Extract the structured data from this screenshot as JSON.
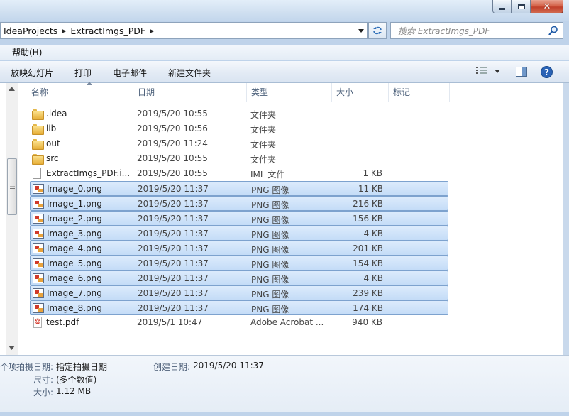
{
  "window": {
    "minimize_glyph": "",
    "close_glyph": "✕"
  },
  "address": {
    "crumbs": [
      "IdeaProjects",
      "ExtractImgs_PDF"
    ],
    "separator": "▶"
  },
  "search": {
    "placeholder": "搜索 ExtractImgs_PDF"
  },
  "menu": {
    "help": "帮助(H)"
  },
  "toolbar": {
    "slideshow": "放映幻灯片",
    "print": "打印",
    "email": "电子邮件",
    "new_folder": "新建文件夹"
  },
  "columns": {
    "name": "名称",
    "date": "日期",
    "type": "类型",
    "size": "大小",
    "tags": "标记"
  },
  "files": [
    {
      "name": ".idea",
      "date": "2019/5/20 10:55",
      "type": "文件夹",
      "size": "",
      "icon": "folder-icon",
      "selected": false
    },
    {
      "name": "lib",
      "date": "2019/5/20 10:56",
      "type": "文件夹",
      "size": "",
      "icon": "folder-icon",
      "selected": false
    },
    {
      "name": "out",
      "date": "2019/5/20 11:24",
      "type": "文件夹",
      "size": "",
      "icon": "folder-icon",
      "selected": false
    },
    {
      "name": "src",
      "date": "2019/5/20 10:55",
      "type": "文件夹",
      "size": "",
      "icon": "folder-icon",
      "selected": false
    },
    {
      "name": "ExtractImgs_PDF.i...",
      "date": "2019/5/20 10:55",
      "type": "IML 文件",
      "size": "1 KB",
      "icon": "document-icon",
      "selected": false
    },
    {
      "name": "Image_0.png",
      "date": "2019/5/20 11:37",
      "type": "PNG 图像",
      "size": "11 KB",
      "icon": "image-icon",
      "selected": true
    },
    {
      "name": "Image_1.png",
      "date": "2019/5/20 11:37",
      "type": "PNG 图像",
      "size": "216 KB",
      "icon": "image-icon",
      "selected": true
    },
    {
      "name": "Image_2.png",
      "date": "2019/5/20 11:37",
      "type": "PNG 图像",
      "size": "156 KB",
      "icon": "image-icon",
      "selected": true
    },
    {
      "name": "Image_3.png",
      "date": "2019/5/20 11:37",
      "type": "PNG 图像",
      "size": "4 KB",
      "icon": "image-icon",
      "selected": true
    },
    {
      "name": "Image_4.png",
      "date": "2019/5/20 11:37",
      "type": "PNG 图像",
      "size": "201 KB",
      "icon": "image-icon",
      "selected": true
    },
    {
      "name": "Image_5.png",
      "date": "2019/5/20 11:37",
      "type": "PNG 图像",
      "size": "154 KB",
      "icon": "image-icon",
      "selected": true
    },
    {
      "name": "Image_6.png",
      "date": "2019/5/20 11:37",
      "type": "PNG 图像",
      "size": "4 KB",
      "icon": "image-icon",
      "selected": true
    },
    {
      "name": "Image_7.png",
      "date": "2019/5/20 11:37",
      "type": "PNG 图像",
      "size": "239 KB",
      "icon": "image-icon",
      "selected": true
    },
    {
      "name": "Image_8.png",
      "date": "2019/5/20 11:37",
      "type": "PNG 图像",
      "size": "174 KB",
      "icon": "image-icon",
      "selected": true
    },
    {
      "name": "test.pdf",
      "date": "2019/5/1 10:47",
      "type": "Adobe Acrobat ...",
      "size": "940 KB",
      "icon": "pdf-icon",
      "selected": false
    }
  ],
  "details": {
    "count_suffix": "个项",
    "date_taken_label": "拍摄日期:",
    "date_taken_value": "指定拍摄日期",
    "created_label": "创建日期:",
    "created_value": "2019/5/20 11:37",
    "dimensions_label": "尺寸:",
    "dimensions_value": "(多个数值)",
    "size_label": "大小:",
    "size_value": "1.12 MB"
  },
  "colors": {
    "selection": "#c4dcf7",
    "selection_border": "#7da2ce",
    "chrome": "#bfd3ea"
  }
}
